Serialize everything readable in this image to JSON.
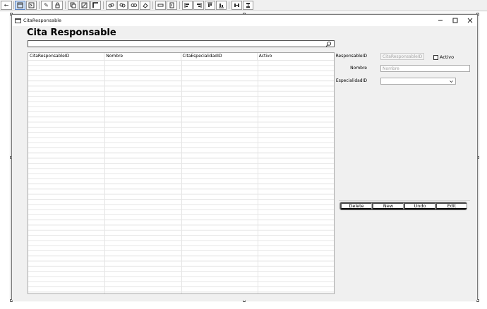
{
  "window": {
    "title": "CitaResponsable"
  },
  "form": {
    "title": "Cita Responsable"
  },
  "search": {
    "value": "",
    "placeholder": ""
  },
  "grid": {
    "columns": [
      "CitaResponsableID",
      "Nombre",
      "CitaEspecialidadID",
      "Activo"
    ],
    "rows": []
  },
  "fields": {
    "responsable_label": "ResponsableID",
    "responsable_placeholder": "CitaResponsableID",
    "activo_label": "Activo",
    "nombre_label": "Nombre",
    "nombre_placeholder": "Nombre",
    "especialidad_label": "EspecialidadID",
    "especialidad_value": ""
  },
  "actions": {
    "delete": "Delete",
    "new": "New",
    "undo": "Undo",
    "edit": "Edit"
  },
  "colors": {
    "window_bg": "#f0f0f0",
    "canvas_bg": "#ffffff",
    "toolbar_active": "#cfe0f5"
  }
}
